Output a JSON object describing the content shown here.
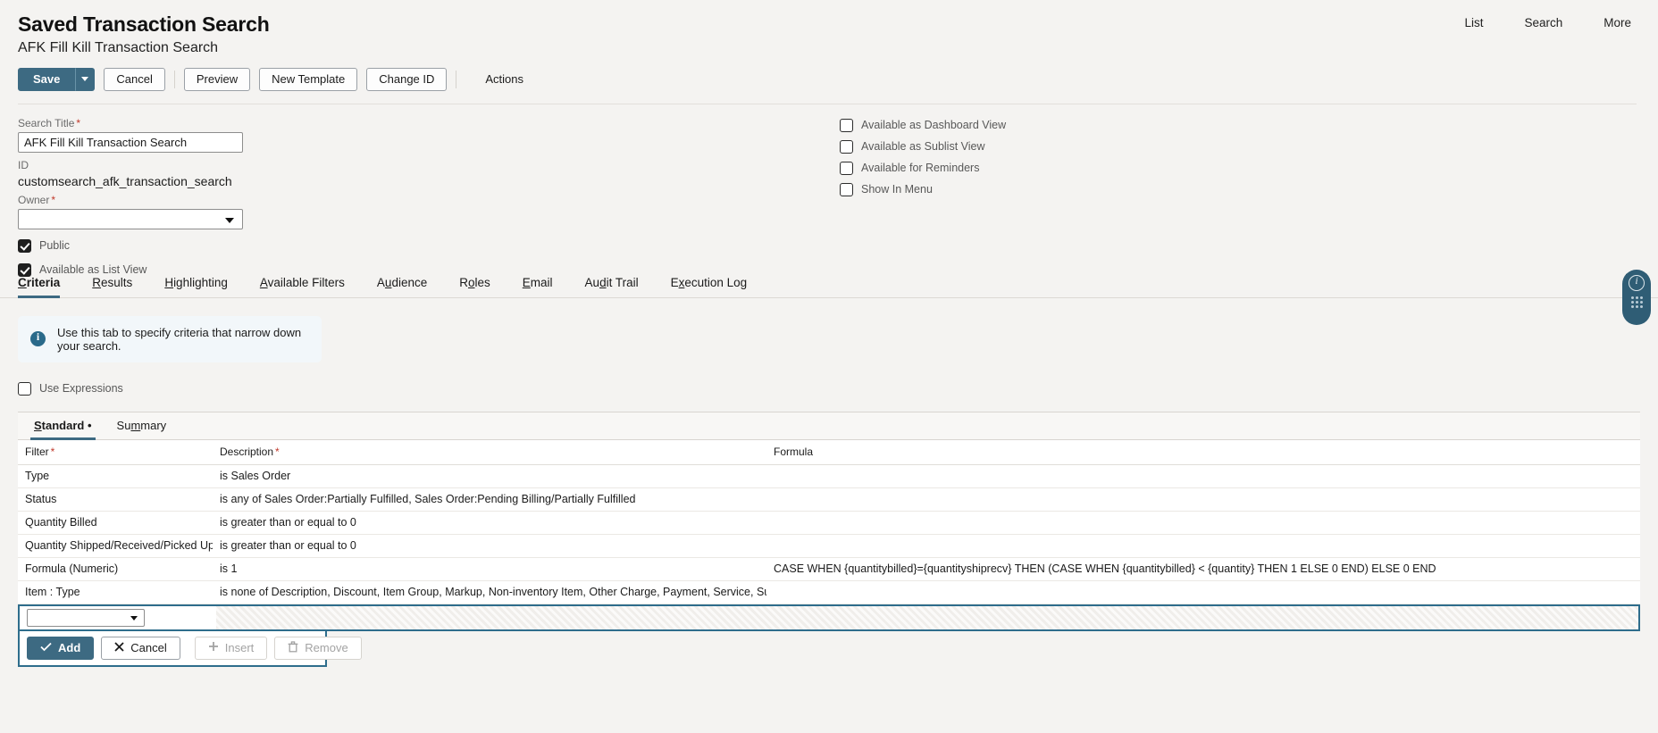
{
  "header": {
    "title": "Saved Transaction Search",
    "subtitle": "AFK Fill Kill Transaction Search",
    "nav": [
      {
        "label": "List"
      },
      {
        "label": "Search"
      },
      {
        "label": "More"
      }
    ]
  },
  "toolbar": {
    "save_label": "Save",
    "save_caret_label": "",
    "cancel_label": "Cancel",
    "preview_label": "Preview",
    "new_template_label": "New Template",
    "change_id_label": "Change ID",
    "actions_label": "Actions"
  },
  "form": {
    "search_title_label": "Search Title",
    "search_title_value": "AFK Fill Kill Transaction Search",
    "search_title_placeholder": "",
    "id_label": "ID",
    "id_value": "customsearch_afk_transaction_search",
    "owner_label": "Owner",
    "owner_value": "",
    "left_checkboxes": [
      {
        "label": "Public",
        "checked": true
      },
      {
        "label": "Available as List View",
        "checked": true
      }
    ],
    "right_checkboxes": [
      {
        "label": "Available as Dashboard View",
        "checked": false
      },
      {
        "label": "Available as Sublist View",
        "checked": false
      },
      {
        "label": "Available for Reminders",
        "checked": false
      },
      {
        "label": "Show In Menu",
        "checked": false
      }
    ]
  },
  "tabs": [
    {
      "label": "Criteria",
      "accesskey": "C",
      "active": true
    },
    {
      "label": "Results",
      "accesskey": "R",
      "active": false
    },
    {
      "label": "Highlighting",
      "accesskey": "H",
      "active": false
    },
    {
      "label": "Available Filters",
      "accesskey": "A",
      "active": false
    },
    {
      "label": "Audience",
      "accesskey": "u",
      "active": false
    },
    {
      "label": "Roles",
      "accesskey": "o",
      "active": false
    },
    {
      "label": "Email",
      "accesskey": "E",
      "active": false
    },
    {
      "label": "Audit Trail",
      "accesskey": "d",
      "active": false
    },
    {
      "label": "Execution Log",
      "accesskey": "x",
      "active": false
    }
  ],
  "criteria": {
    "banner_text": "Use this tab to specify criteria that narrow down your search.",
    "use_expressions_label": "Use Expressions",
    "use_expressions_checked": false,
    "subtabs": [
      {
        "label": "Standard",
        "marker": "•",
        "active": true
      },
      {
        "label": "Summary",
        "marker": "",
        "active": false
      }
    ],
    "columns": {
      "filter": "Filter",
      "description": "Description",
      "formula": "Formula"
    },
    "rows": [
      {
        "filter": "Type",
        "description": "is Sales Order",
        "formula": ""
      },
      {
        "filter": "Status",
        "description": "is any of Sales Order:Partially Fulfilled, Sales Order:Pending Billing/Partially Fulfilled",
        "formula": ""
      },
      {
        "filter": "Quantity Billed",
        "description": "is greater than or equal to 0",
        "formula": ""
      },
      {
        "filter": "Quantity Shipped/Received/Picked Up",
        "description": "is greater than or equal to 0",
        "formula": ""
      },
      {
        "filter": "Formula (Numeric)",
        "description": "is 1",
        "formula": "CASE WHEN {quantitybilled}={quantityshiprecv} THEN (CASE WHEN {quantitybilled} < {quantity} THEN 1 ELSE 0 END) ELSE 0 END"
      },
      {
        "filter": "Item : Type",
        "description": "is none of Description, Discount, Item Group, Markup, Non-inventory Item, Other Charge, Payment, Service, Subtotal",
        "formula": ""
      }
    ],
    "new_row": {
      "filter_value": ""
    },
    "row_actions": {
      "add_label": "Add",
      "cancel_label": "Cancel",
      "insert_label": "Insert",
      "remove_label": "Remove"
    }
  },
  "colors": {
    "accent": "#3d6a82",
    "page_bg": "#f4f3f1",
    "required": "#c0392b",
    "banner_bg": "#f2f7fa"
  }
}
